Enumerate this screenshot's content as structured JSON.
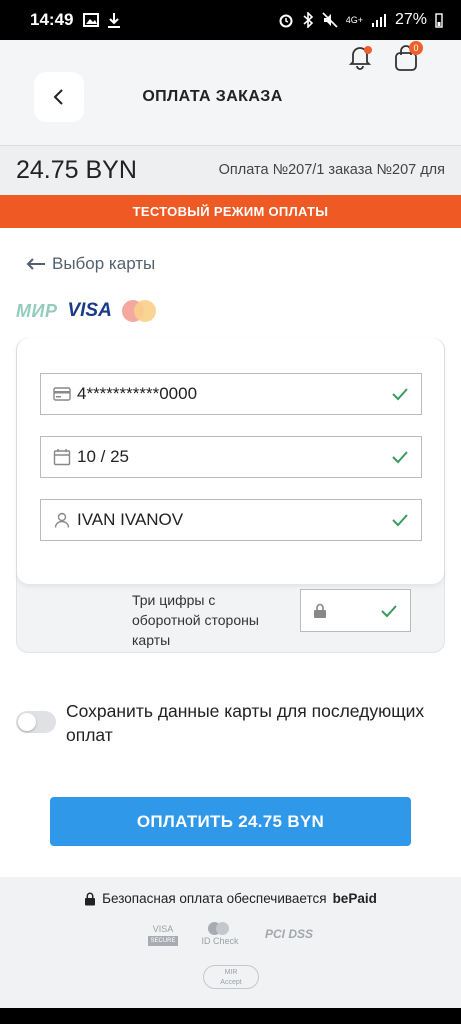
{
  "status_bar": {
    "time": "14:49",
    "network": "4G+",
    "battery": "27%"
  },
  "header": {
    "title": "ОПЛАТА ЗАКАЗА",
    "cart_count": "0"
  },
  "order": {
    "amount": "24.75 BYN",
    "description": "Оплата №207/1 заказа №207 для"
  },
  "banner": {
    "text": "ТЕСТОВЫЙ РЕЖИМ ОПЛАТЫ"
  },
  "card_choice": {
    "label": "Выбор карты"
  },
  "brands": {
    "mir": "МИР",
    "visa": "VISA"
  },
  "form": {
    "card_number": "4***********0000",
    "expiry": "10 / 25",
    "holder": "IVAN IVANOV",
    "cvv_label": "Три цифры с оборотной стороны карты"
  },
  "save_card": {
    "label": "Сохранить данные карты для последующих оплат"
  },
  "pay_button": {
    "label": "ОПЛАТИТЬ 24.75 BYN"
  },
  "footer": {
    "secure_text": "Безопасная оплата обеспечивается",
    "provider": "bePaid",
    "seals": {
      "visa": "VISA",
      "visa_sub": "SECURE",
      "idcheck": "ID Check",
      "pci": "PCI DSS",
      "mir": "MIR",
      "mir_sub": "Accept"
    }
  },
  "colors": {
    "accent_orange": "#ef5a24",
    "pay_blue": "#2f98e9",
    "check_green": "#3a9b5c"
  }
}
